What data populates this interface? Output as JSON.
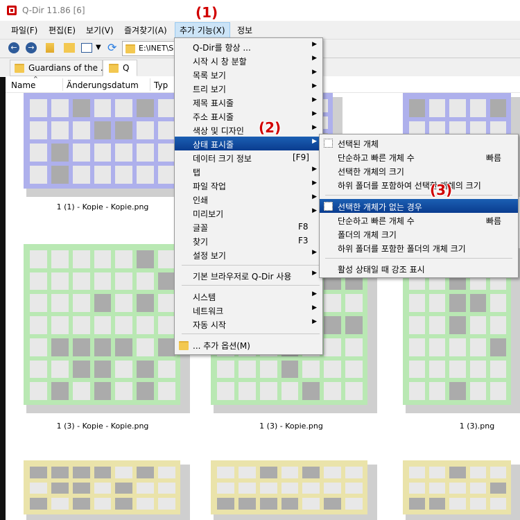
{
  "window": {
    "title": "Q-Dir 11.86 [6]"
  },
  "menubar": {
    "items": [
      {
        "label": "파일(F)"
      },
      {
        "label": "편집(E)"
      },
      {
        "label": "보기(V)"
      },
      {
        "label": "즐겨찾기(A)"
      },
      {
        "label": "추가 기능(X)"
      },
      {
        "label": "정보"
      }
    ]
  },
  "toolbar": {
    "address": "E:\\INET\\So"
  },
  "tabs": [
    {
      "label": "Guardians of the ..."
    },
    {
      "label": "Q"
    }
  ],
  "columns": [
    "Name",
    "Änderungsdatum",
    "Typ"
  ],
  "files": [
    {
      "caption": "1 (1) - Kopie - Kopie.png"
    },
    {
      "caption": "1 (3) - Kopie - Kopie.png"
    },
    {
      "caption": "1 (3) - Kopie.png"
    },
    {
      "caption": "1 (3).png"
    }
  ],
  "colors": {
    "purple": "#aeb0ec",
    "green": "#b9e8b3",
    "yellow": "#eae3aa",
    "highlight": "#0a3c8f"
  },
  "menu_extra": {
    "items": [
      {
        "label": "Q-Dir를 항상 ..."
      },
      {
        "label": "시작 시 창 분할"
      },
      {
        "label": "목록 보기"
      },
      {
        "label": "트리 보기"
      },
      {
        "label": "제목 표시줄"
      },
      {
        "label": "주소 표시줄"
      },
      {
        "label": "색상 및 디자인"
      },
      {
        "label": "상태 표시줄"
      },
      {
        "label": "데이터 크기 정보",
        "shortcut": "[F9]"
      },
      {
        "label": "탭"
      },
      {
        "label": "파일 작업"
      },
      {
        "label": "인쇄"
      },
      {
        "label": "미리보기"
      },
      {
        "label": "글꼴",
        "shortcut": "F8"
      },
      {
        "label": "찾기",
        "shortcut": "F3"
      },
      {
        "label": "설정 보기"
      },
      {
        "label": "기본 브라우저로 Q-Dir 사용"
      },
      {
        "label": "시스템"
      },
      {
        "label": "네트워크"
      },
      {
        "label": "자동 시작"
      },
      {
        "label": "... 추가 옵션(M)"
      }
    ]
  },
  "submenu_status": {
    "items": [
      {
        "label": "선택된 개체"
      },
      {
        "label": "단순하고 빠른 개체 수",
        "right": "빠름"
      },
      {
        "label": "선택한 개체의 크기"
      },
      {
        "label": "하위 폴더를 포함하여 선택한 개체의 크기"
      },
      {
        "label": "선택한 개체가 없는 경우"
      },
      {
        "label": "단순하고 빠른 개체 수",
        "right": "빠름"
      },
      {
        "label": "폴더의 개체 크기"
      },
      {
        "label": "하위 폴더를 포함한 폴더의 개체 크기"
      },
      {
        "label": "활성 상태일 때 강조 표시"
      }
    ]
  },
  "annotations": [
    "(1)",
    "(2)",
    "(3)"
  ]
}
